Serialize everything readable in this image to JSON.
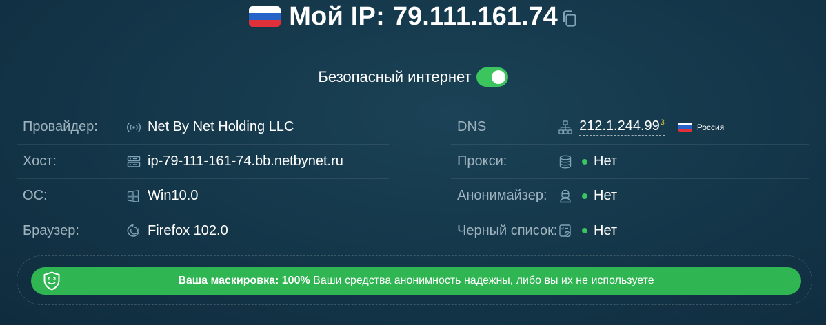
{
  "header": {
    "flag_country": "Russia",
    "title_label": "Мой IP:",
    "ip": "79.111.161.74",
    "copy_icon": "copy-icon"
  },
  "safe_internet": {
    "label": "Безопасный интернет",
    "enabled": true
  },
  "left_rows": [
    {
      "label": "Провайдер:",
      "icon": "signal-icon",
      "value": "Net By Net Holding LLC"
    },
    {
      "label": "Хост:",
      "icon": "server-icon",
      "value": "ip-79-111-161-74.bb.netbynet.ru"
    },
    {
      "label": "ОС:",
      "icon": "windows-icon",
      "value": "Win10.0"
    },
    {
      "label": "Браузер:",
      "icon": "browser-icon",
      "value": "Firefox 102.0"
    }
  ],
  "right_rows": [
    {
      "label": "DNS",
      "icon": "network-icon",
      "value": "212.1.244.99",
      "count": "3",
      "country": "Россия"
    },
    {
      "label": "Прокси:",
      "icon": "database-icon",
      "value": "Нет"
    },
    {
      "label": "Анонимайзер:",
      "icon": "anonymizer-icon",
      "value": "Нет"
    },
    {
      "label": "Черный список:",
      "icon": "blacklist-icon",
      "value": "Нет"
    }
  ],
  "mask": {
    "label": "Ваша маскировка: 100%",
    "percent": 100,
    "message": " Ваши средства анонимность надежны, либо вы их не используете"
  },
  "colors": {
    "background": "#163a4d",
    "accent_green": "#2fb552",
    "toggle_green": "#3cc45e",
    "label_gray": "#9fb3bf",
    "superscript_yellow": "#e8c14a"
  }
}
